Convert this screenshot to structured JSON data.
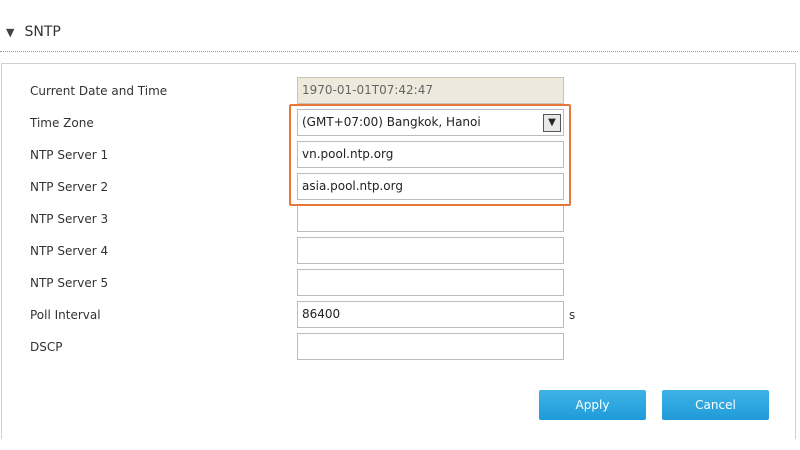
{
  "section": {
    "caret": "▼",
    "title": "SNTP"
  },
  "form": {
    "current_datetime": {
      "label": "Current Date and Time",
      "value": "1970-01-01T07:42:47"
    },
    "time_zone": {
      "label": "Time Zone",
      "value": "(GMT+07:00) Bangkok, Hanoi"
    },
    "ntp_server_1": {
      "label": "NTP Server 1",
      "value": "vn.pool.ntp.org"
    },
    "ntp_server_2": {
      "label": "NTP Server 2",
      "value": "asia.pool.ntp.org"
    },
    "ntp_server_3": {
      "label": "NTP Server 3",
      "value": ""
    },
    "ntp_server_4": {
      "label": "NTP Server 4",
      "value": ""
    },
    "ntp_server_5": {
      "label": "NTP Server 5",
      "value": ""
    },
    "poll_interval": {
      "label": "Poll Interval",
      "value": "86400",
      "unit": "s"
    },
    "dscp": {
      "label": "DSCP",
      "value": ""
    }
  },
  "buttons": {
    "apply": "Apply",
    "cancel": "Cancel"
  },
  "colors": {
    "highlight": "#e8783a",
    "button": "#29a6e0",
    "readonly_field": "#ede9dc"
  }
}
